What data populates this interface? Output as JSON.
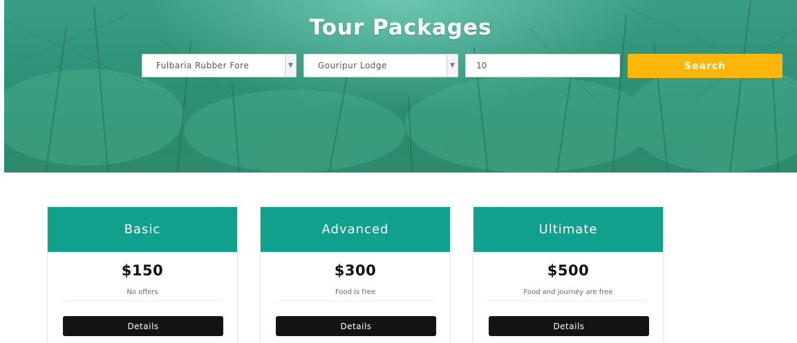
{
  "hero": {
    "title": "Tour Packages",
    "from_select": {
      "value": "Fulbaria Rubber Fore"
    },
    "to_select": {
      "value": "Gouripur Lodge"
    },
    "people_input": {
      "value": "10"
    },
    "search_label": "Search"
  },
  "packages": [
    {
      "name": "Basic",
      "price": "$150",
      "description": "No offers",
      "button_label": "Details"
    },
    {
      "name": "Advanced",
      "price": "$300",
      "description": "Food is free",
      "button_label": "Details"
    },
    {
      "name": "Ultimate",
      "price": "$500",
      "description": "Food and journey are free",
      "button_label": "Details"
    }
  ],
  "colors": {
    "card_header": "#10a08b",
    "search_button": "#fdb609",
    "details_button": "#141414",
    "hero_tint": "#2f9479"
  }
}
